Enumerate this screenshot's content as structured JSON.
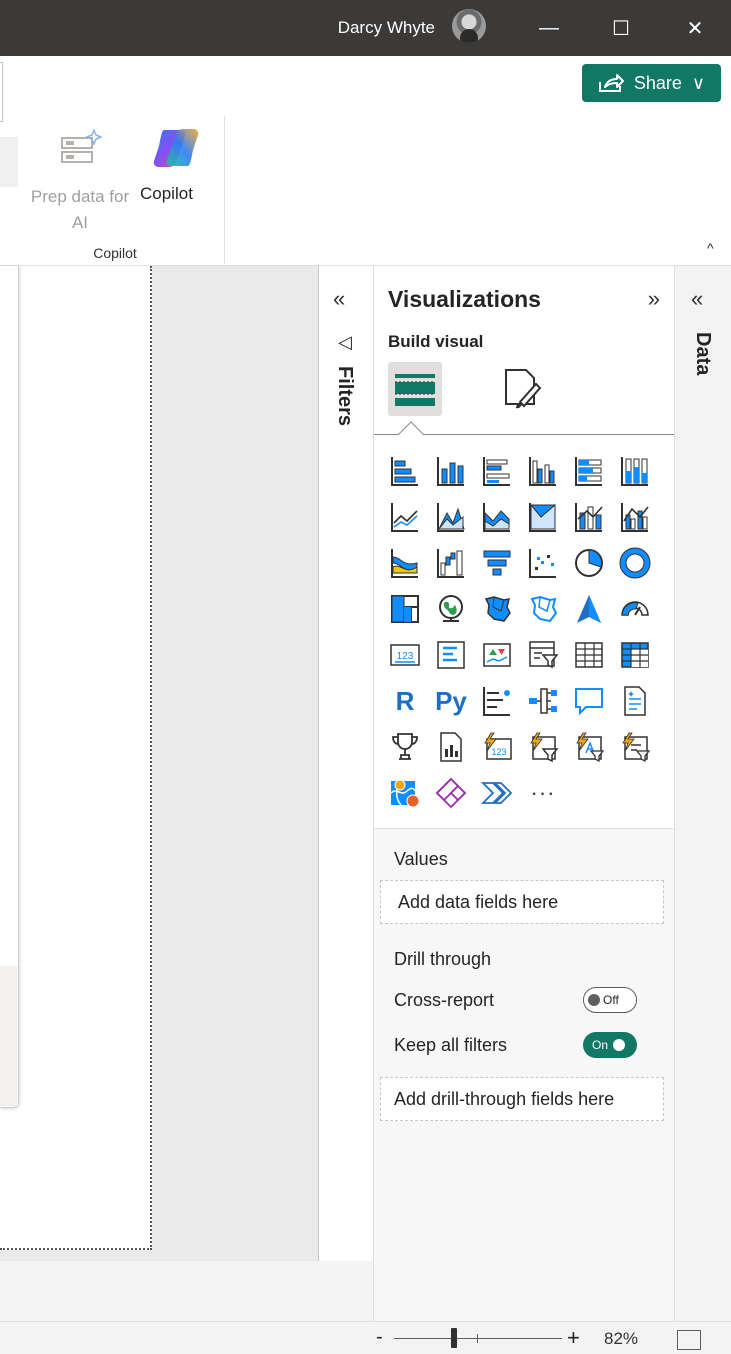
{
  "titlebar": {
    "user_name": "Darcy Whyte",
    "minimize": "—",
    "maximize": "☐",
    "close": "✕"
  },
  "ribbon": {
    "share_label": "Share",
    "share_chevron": "∨",
    "prep_data_label": "Prep data for AI",
    "copilot_label": "Copilot",
    "group_label": "Copilot",
    "collapse_caret": "^"
  },
  "filters_pane": {
    "collapse_chevron": "«",
    "title": "Filters",
    "funnel": "◁"
  },
  "visualizations": {
    "title": "Visualizations",
    "expand_chevron": "»",
    "build_visual_label": "Build visual",
    "r_label": "R",
    "py_label": "Py",
    "more_label": "···"
  },
  "wells": {
    "values_label": "Values",
    "values_placeholder": "Add data fields here",
    "drill_through_label": "Drill through",
    "cross_report_label": "Cross-report",
    "cross_report_toggle": "Off",
    "keep_filters_label": "Keep all filters",
    "keep_filters_toggle": "On",
    "drill_placeholder": "Add drill-through fields here"
  },
  "data_pane": {
    "collapse_chevron": "«",
    "title": "Data"
  },
  "statusbar": {
    "zoom_minus": "-",
    "zoom_plus": "+",
    "zoom_level": "82%",
    "zoom_fraction": 0.36
  },
  "colors": {
    "accent": "#117865",
    "titlebar": "#3b3a39",
    "chart_blue": "#1e6fc4",
    "chart_teal": "#118dff"
  }
}
